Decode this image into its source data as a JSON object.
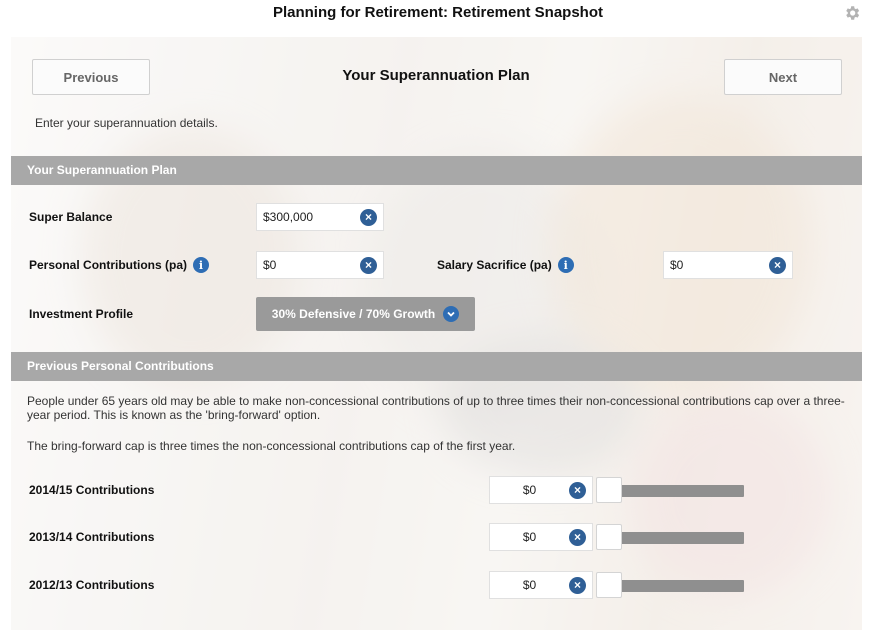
{
  "app": {
    "title": "Planning for Retirement: Retirement Snapshot",
    "settings_icon": "gear-icon"
  },
  "nav": {
    "previous_label": "Previous",
    "next_label": "Next",
    "page_title": "Your Superannuation Plan"
  },
  "intro_text": "Enter your superannuation details.",
  "plan_section": {
    "header": "Your Superannuation Plan",
    "super_balance": {
      "label": "Super Balance",
      "value": "$300,000"
    },
    "personal_contributions": {
      "label": "Personal Contributions (pa)",
      "value": "$0"
    },
    "salary_sacrifice": {
      "label": "Salary Sacrifice (pa)",
      "value": "$0"
    },
    "investment_profile": {
      "label": "Investment Profile",
      "selected": "30% Defensive / 70% Growth"
    }
  },
  "previous_section": {
    "header": "Previous Personal Contributions",
    "paragraph1": "People under 65 years old may be able to make non-concessional contributions of up to three times their non-concessional contributions cap over a three-year period. This is known as the 'bring-forward' option.",
    "paragraph2": "The bring-forward cap is three times the non-concessional contributions cap of the first year.",
    "rows": [
      {
        "label": "2014/15 Contributions",
        "value": "$0",
        "slider_level": 0
      },
      {
        "label": "2013/14 Contributions",
        "value": "$0",
        "slider_level": 0
      },
      {
        "label": "2012/13 Contributions",
        "value": "$0",
        "slider_level": 0
      }
    ]
  },
  "colors": {
    "section_header": "#a8a8a8",
    "icon_blue": "#2e6db4",
    "clear_icon": "#2f5f96",
    "select_bg": "#9a9a9a",
    "slider_track": "#8f8f8f"
  }
}
